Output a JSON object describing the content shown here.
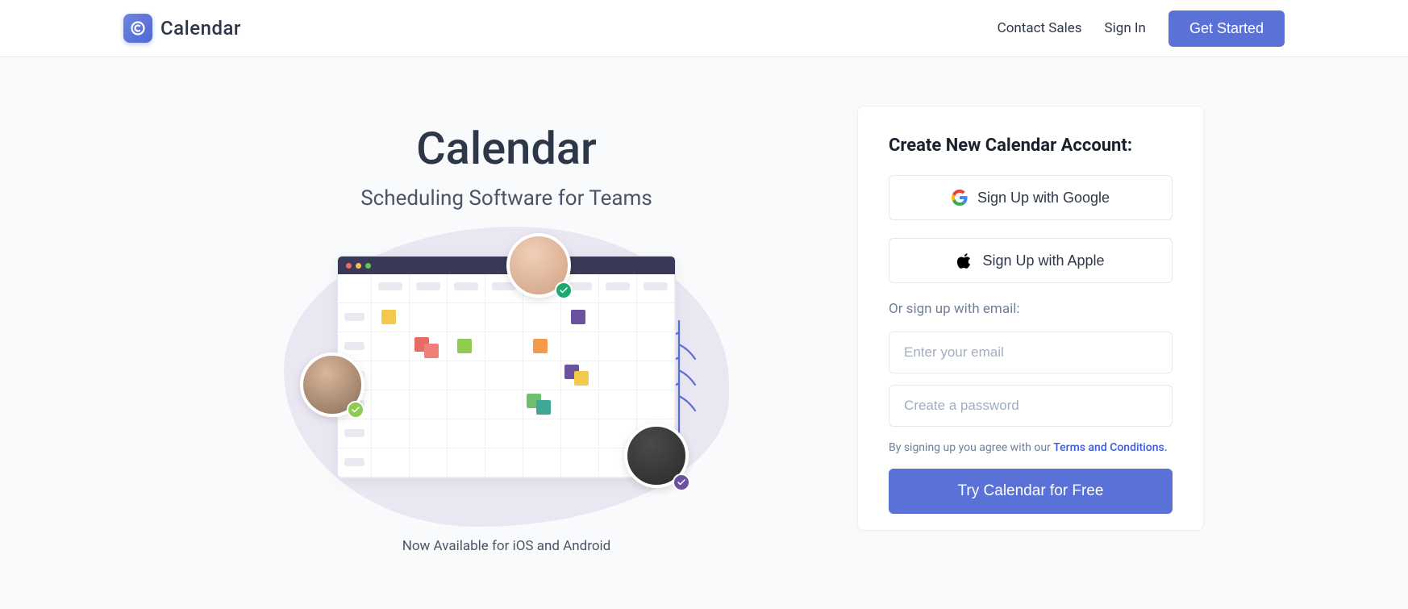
{
  "header": {
    "brand": "Calendar",
    "nav": {
      "contact_sales": "Contact Sales",
      "sign_in": "Sign In",
      "get_started": "Get Started"
    }
  },
  "hero": {
    "title": "Calendar",
    "subtitle": "Scheduling Software for Teams",
    "footnote": "Now Available for iOS and Android"
  },
  "signup": {
    "title": "Create New Calendar Account:",
    "google_label": "Sign Up with Google",
    "apple_label": "Sign Up with Apple",
    "or_label": "Or sign up with email:",
    "email_placeholder": "Enter your email",
    "password_placeholder": "Create a password",
    "terms_prefix": "By signing up you agree with our ",
    "terms_link": "Terms and Conditions.",
    "cta_label": "Try Calendar for Free"
  }
}
